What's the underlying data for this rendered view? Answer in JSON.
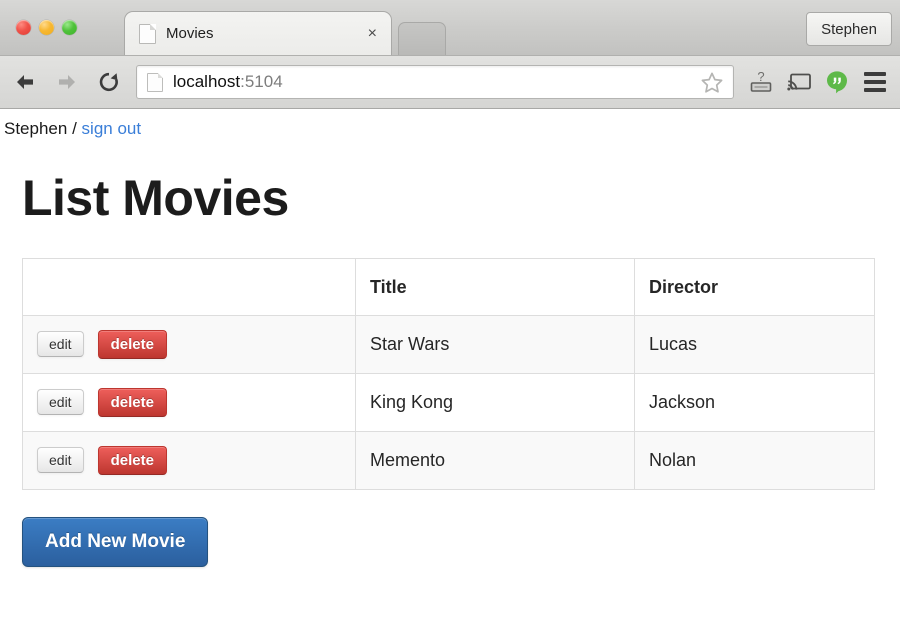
{
  "browser": {
    "traffic_lights": [
      {
        "name": "close",
        "color": "#f05249"
      },
      {
        "name": "minimize",
        "color": "#f7b731"
      },
      {
        "name": "zoom",
        "color": "#4fc23a"
      }
    ],
    "tab": {
      "title": "Movies",
      "favicon": "page-icon",
      "close_label": "×"
    },
    "profile_button": "Stephen",
    "toolbar": {
      "back_icon": "back-arrow-icon",
      "forward_icon": "forward-arrow-icon",
      "reload_icon": "reload-icon",
      "url_host": "localhost",
      "url_port": ":5104",
      "bookmark_icon": "star-icon",
      "help_icon": "question-keyboard-icon",
      "cast_icon": "cast-icon",
      "hangouts_icon": "hangouts-icon",
      "menu_icon": "hamburger-menu-icon",
      "hangouts_color": "#5eb949"
    }
  },
  "page": {
    "user_name": "Stephen",
    "separator": "/",
    "sign_out_label": "sign out",
    "title": "List Movies",
    "add_button_label": "Add New Movie",
    "link_color": "#3a7ed8",
    "primary_color": "#2b5f9e",
    "danger_color": "#bd362f"
  },
  "table": {
    "headers": [
      "",
      "Title",
      "Director"
    ],
    "row_actions": {
      "edit_label": "edit",
      "delete_label": "delete"
    },
    "rows": [
      {
        "title": "Star Wars",
        "director": "Lucas"
      },
      {
        "title": "King Kong",
        "director": "Jackson"
      },
      {
        "title": "Memento",
        "director": "Nolan"
      }
    ]
  }
}
